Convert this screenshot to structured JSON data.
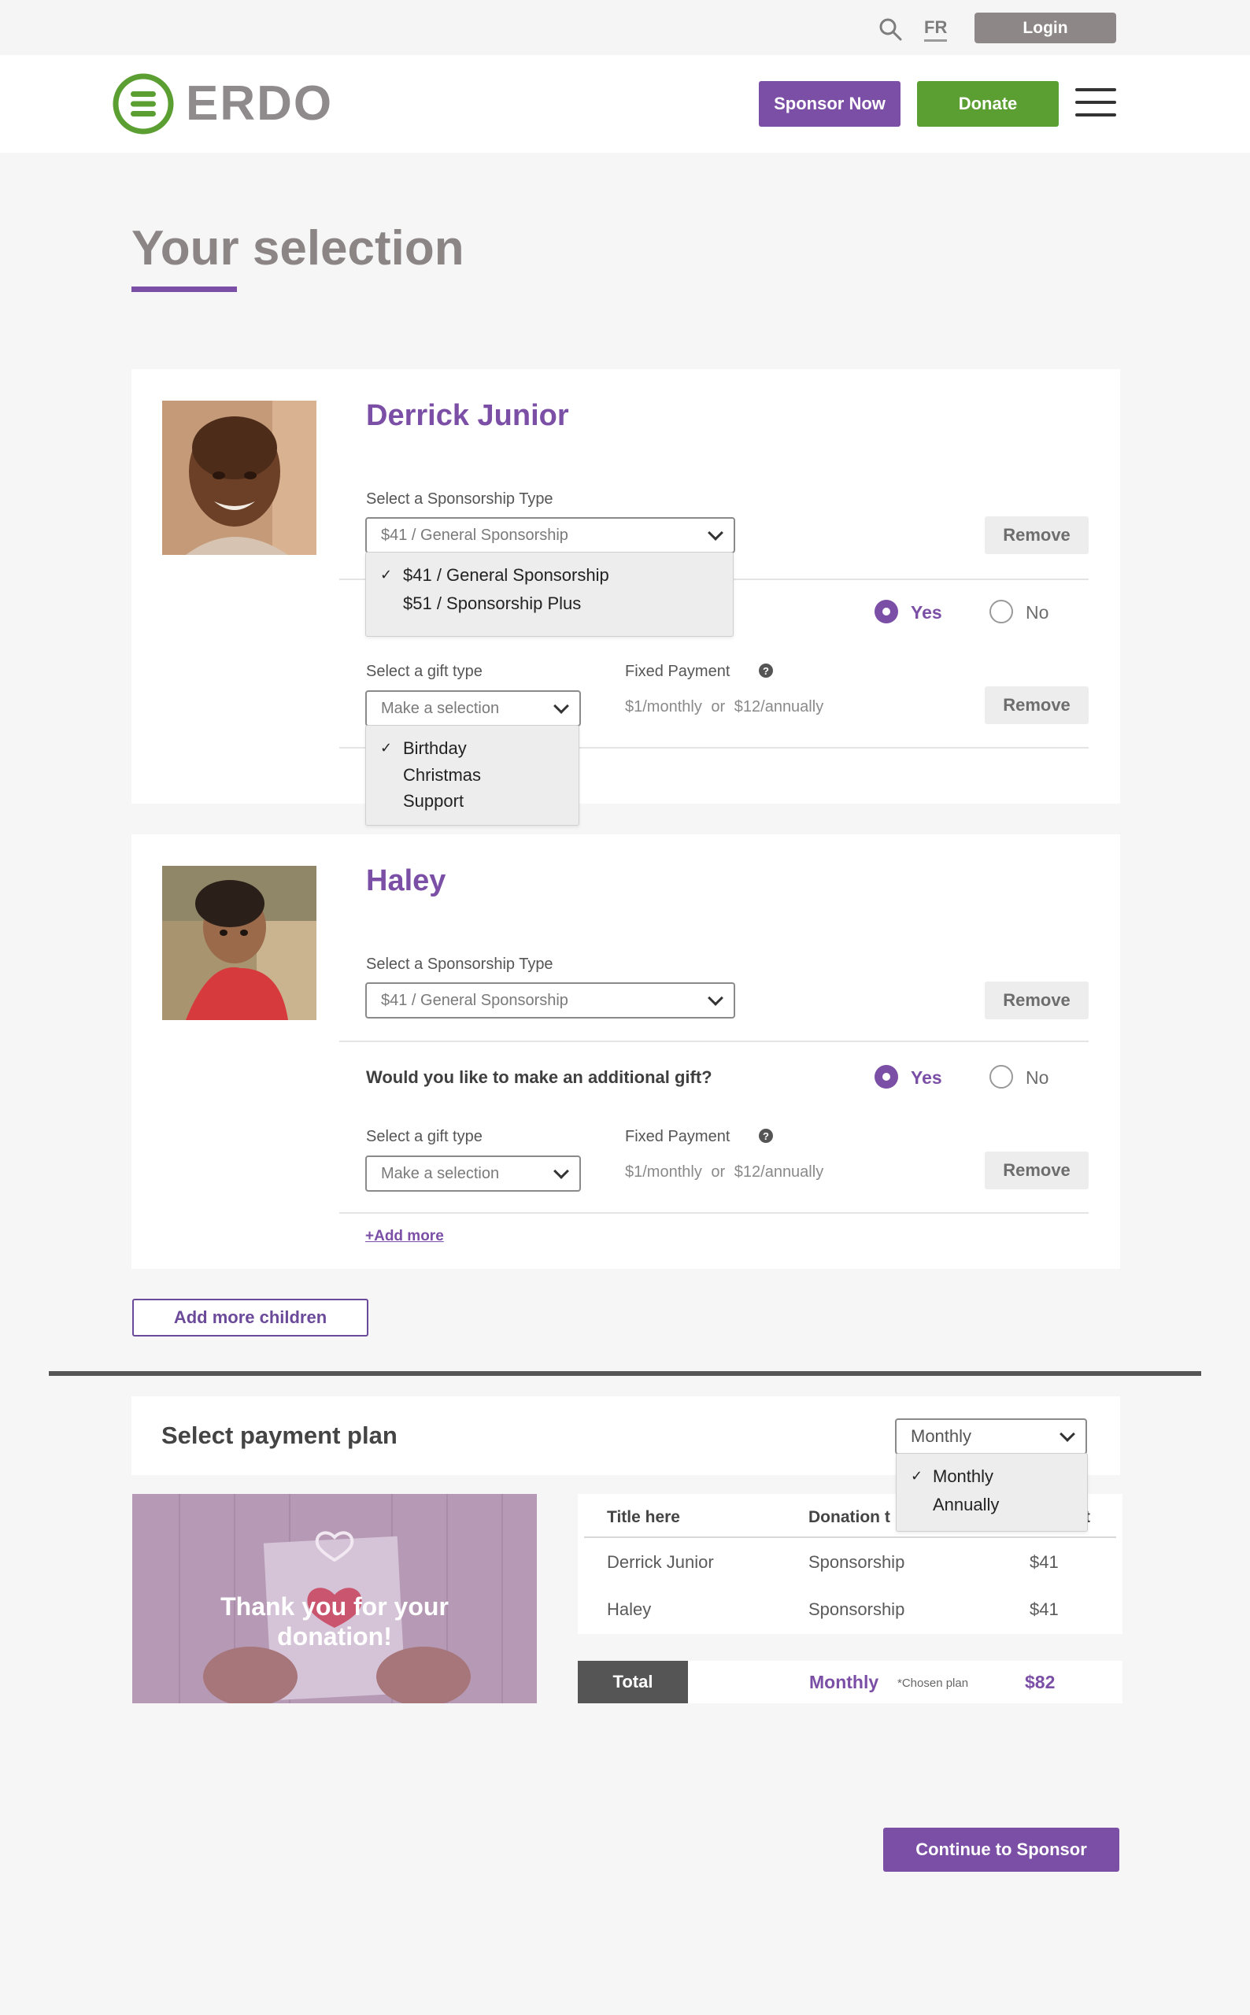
{
  "utility": {
    "lang": "FR",
    "login": "Login"
  },
  "brand": {
    "name": "ERDO",
    "green": "#5b9e32",
    "purple": "#7b4fa6"
  },
  "header": {
    "sponsor_now": "Sponsor Now",
    "donate": "Donate"
  },
  "page": {
    "title": "Your selection"
  },
  "children": [
    {
      "name": "Derrick Junior",
      "sponsorship_label": "Select a Sponsorship Type",
      "sponsorship_value": "$41 / General Sponsorship",
      "sponsorship_options": [
        "$41 / General Sponsorship",
        "$51 / Sponsorship Plus"
      ],
      "remove": "Remove",
      "yes": "Yes",
      "no": "No",
      "gift_label": "Select a gift type",
      "gift_placeholder": "Make a selection",
      "gift_options": [
        "Birthday",
        "Christmas",
        "Support"
      ],
      "fixed_label": "Fixed Payment",
      "fixed_monthly": "$1/monthly",
      "or": "or",
      "fixed_annually": "$12/annually",
      "remove_gift": "Remove"
    },
    {
      "name": "Haley",
      "sponsorship_label": "Select a Sponsorship Type",
      "sponsorship_value": "$41 / General Sponsorship",
      "remove": "Remove",
      "question": "Would you like to make an additional gift?",
      "yes": "Yes",
      "no": "No",
      "gift_label": "Select a gift type",
      "gift_placeholder": "Make a selection",
      "fixed_label": "Fixed Payment",
      "fixed_monthly": "$1/monthly",
      "or": "or",
      "fixed_annually": "$12/annually",
      "remove_gift": "Remove",
      "add_more": "+Add more"
    }
  ],
  "add_more_children": "Add more children",
  "payment": {
    "title": "Select payment plan",
    "plan_value": "Monthly",
    "plan_options": [
      "Monthly",
      "Annually"
    ],
    "thanks_line1": "Thank you for your",
    "thanks_line2": "donation!",
    "table_headers": [
      "Title here",
      "Donation t",
      "t"
    ],
    "rows": [
      {
        "title": "Derrick Junior",
        "type": "Sponsorship",
        "amount": "$41"
      },
      {
        "title": "Haley",
        "type": "Sponsorship",
        "amount": "$41"
      }
    ],
    "total_label": "Total",
    "total_plan": "Monthly",
    "chosen_note": "*Chosen plan",
    "total_amount": "$82"
  },
  "continue": "Continue to Sponsor"
}
